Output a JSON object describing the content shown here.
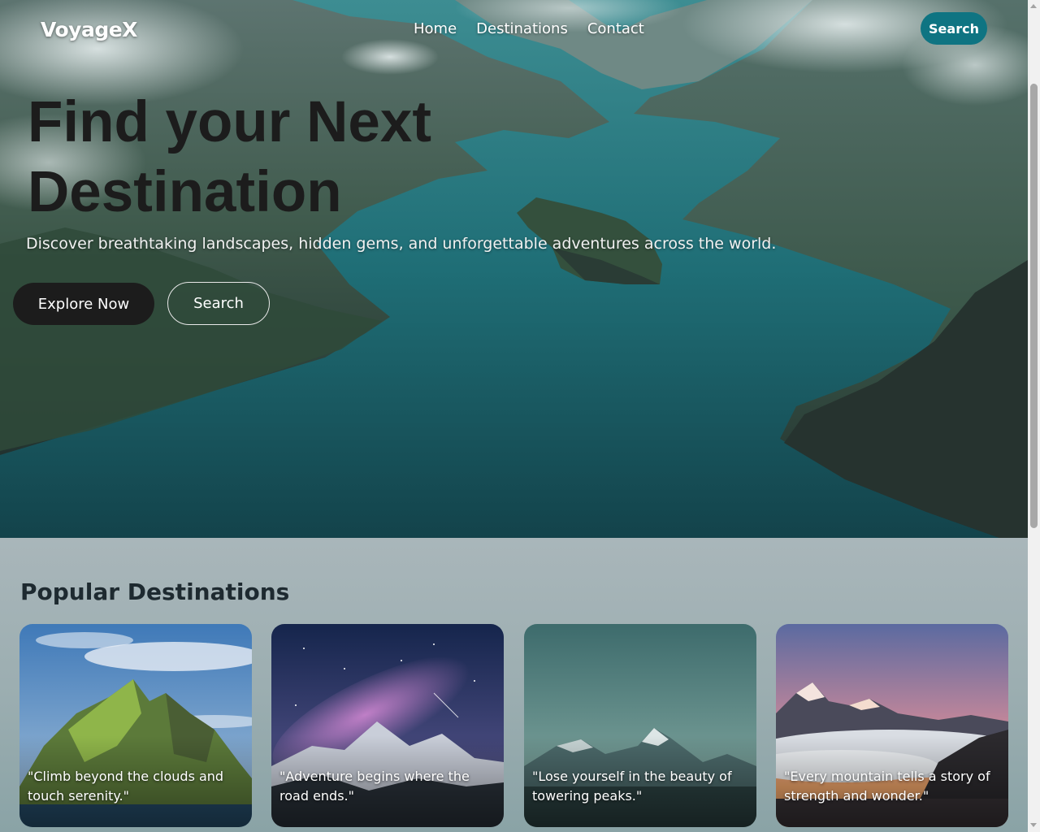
{
  "navbar": {
    "logo": "VoyageX",
    "links": [
      "Home",
      "Destinations",
      "Contact"
    ],
    "search_label": "Search",
    "accent_color": "#0f7482"
  },
  "hero": {
    "title": "Find your Next Destination",
    "subtitle": "Discover breathtaking landscapes, hidden gems, and unforgettable adventures across the world.",
    "primary_button": "Explore Now",
    "secondary_button": "Search"
  },
  "destinations": {
    "title": "Popular Destinations",
    "cards": [
      {
        "quote": "\"Climb beyond the clouds and touch serenity.\""
      },
      {
        "quote": "\"Adventure begins where the road ends.\""
      },
      {
        "quote": "\"Lose yourself in the beauty of towering peaks.\""
      },
      {
        "quote": "\"Every mountain tells a story of strength and wonder.\""
      }
    ]
  }
}
